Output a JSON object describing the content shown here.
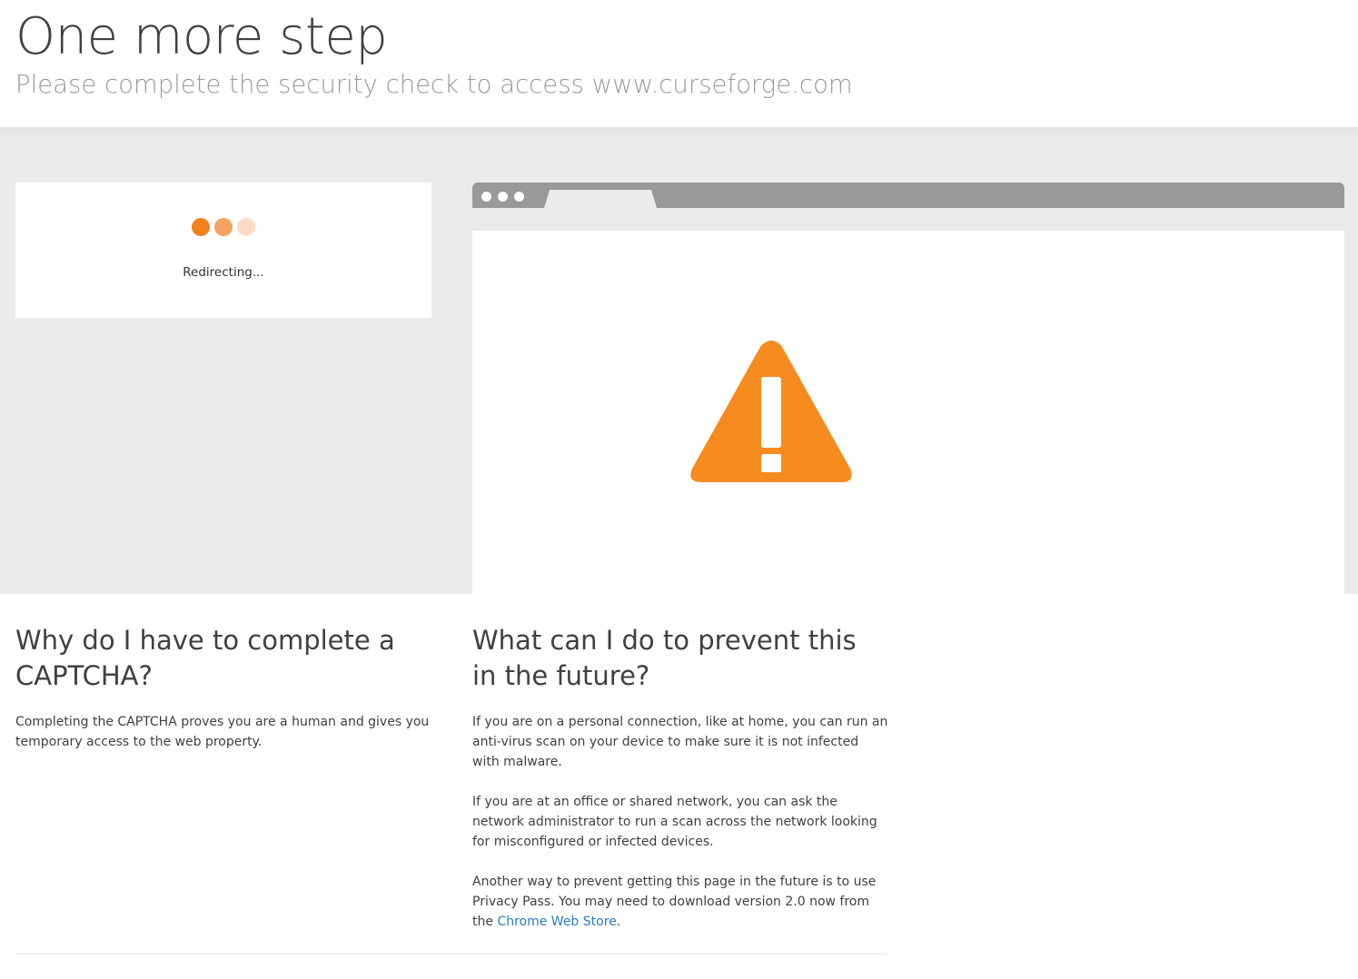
{
  "header": {
    "title": "One more step",
    "subtitle": "Please complete the security check to access www.curseforge.com"
  },
  "status": {
    "text": "Redirecting..."
  },
  "icons": {
    "loading": "loading-dots-icon",
    "warning": "warning-triangle-icon"
  },
  "colors": {
    "accent": "#f38120",
    "accent_mid": "#f4a462",
    "accent_light": "#fbdcc3",
    "link": "#2f7bbf",
    "browser_bar": "#999999",
    "band": "#ebebeb"
  },
  "why": {
    "heading": "Why do I have to complete a CAPTCHA?",
    "body": "Completing the CAPTCHA proves you are a human and gives you temporary access to the web property."
  },
  "prevent": {
    "heading": "What can I do to prevent this in the future?",
    "p1": "If you are on a personal connection, like at home, you can run an anti-virus scan on your device to make sure it is not infected with malware.",
    "p2": "If you are at an office or shared network, you can ask the network administrator to run a scan across the network looking for misconfigured or infected devices.",
    "p3_before": "Another way to prevent getting this page in the future is to use Privacy Pass. You may need to download version 2.0 now from the ",
    "p3_link": "Chrome Web Store",
    "p3_after": "."
  }
}
